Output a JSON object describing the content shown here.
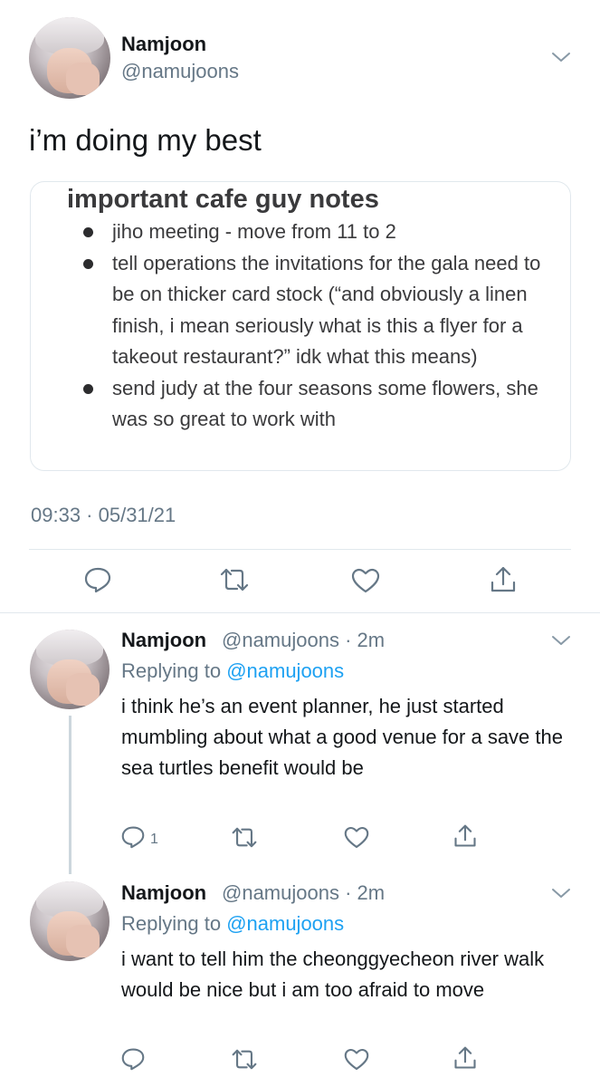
{
  "main_tweet": {
    "name": "Namjoon",
    "handle": "@namujoons",
    "text": "i’m doing my best",
    "timestamp": "09:33 · 05/31/21"
  },
  "notes_card": {
    "title": "important cafe guy notes",
    "items": [
      "jiho meeting - move from 11 to 2",
      "tell operations the invitations for the gala need to be on thicker card stock (“and obviously a linen finish, i mean seriously what is this a flyer for a takeout restaurant?” idk what this means)",
      "send judy at the four seasons some flowers, she was so great to work with"
    ]
  },
  "replies": [
    {
      "name": "Namjoon",
      "handle_time": "@namujoons · 2m",
      "replying_prefix": "Replying to ",
      "replying_handle": "@namujoons",
      "text": "i think he’s an event planner, he just started mumbling about what a good venue for a save the sea turtles benefit would be",
      "reply_count": "1"
    },
    {
      "name": "Namjoon",
      "handle_time": "@namujoons · 2m",
      "replying_prefix": "Replying to ",
      "replying_handle": "@namujoons",
      "text": "i want to tell him the cheonggyecheon river walk would be nice but i am too afraid to move"
    }
  ],
  "icons": {
    "more": "chevron-down-icon",
    "reply": "reply-icon",
    "retweet": "retweet-icon",
    "like": "heart-icon",
    "share": "share-icon"
  },
  "colors": {
    "link": "#1da1f2",
    "secondary_text": "#657786",
    "icon": "#657786",
    "divider": "#e1e8ed"
  }
}
